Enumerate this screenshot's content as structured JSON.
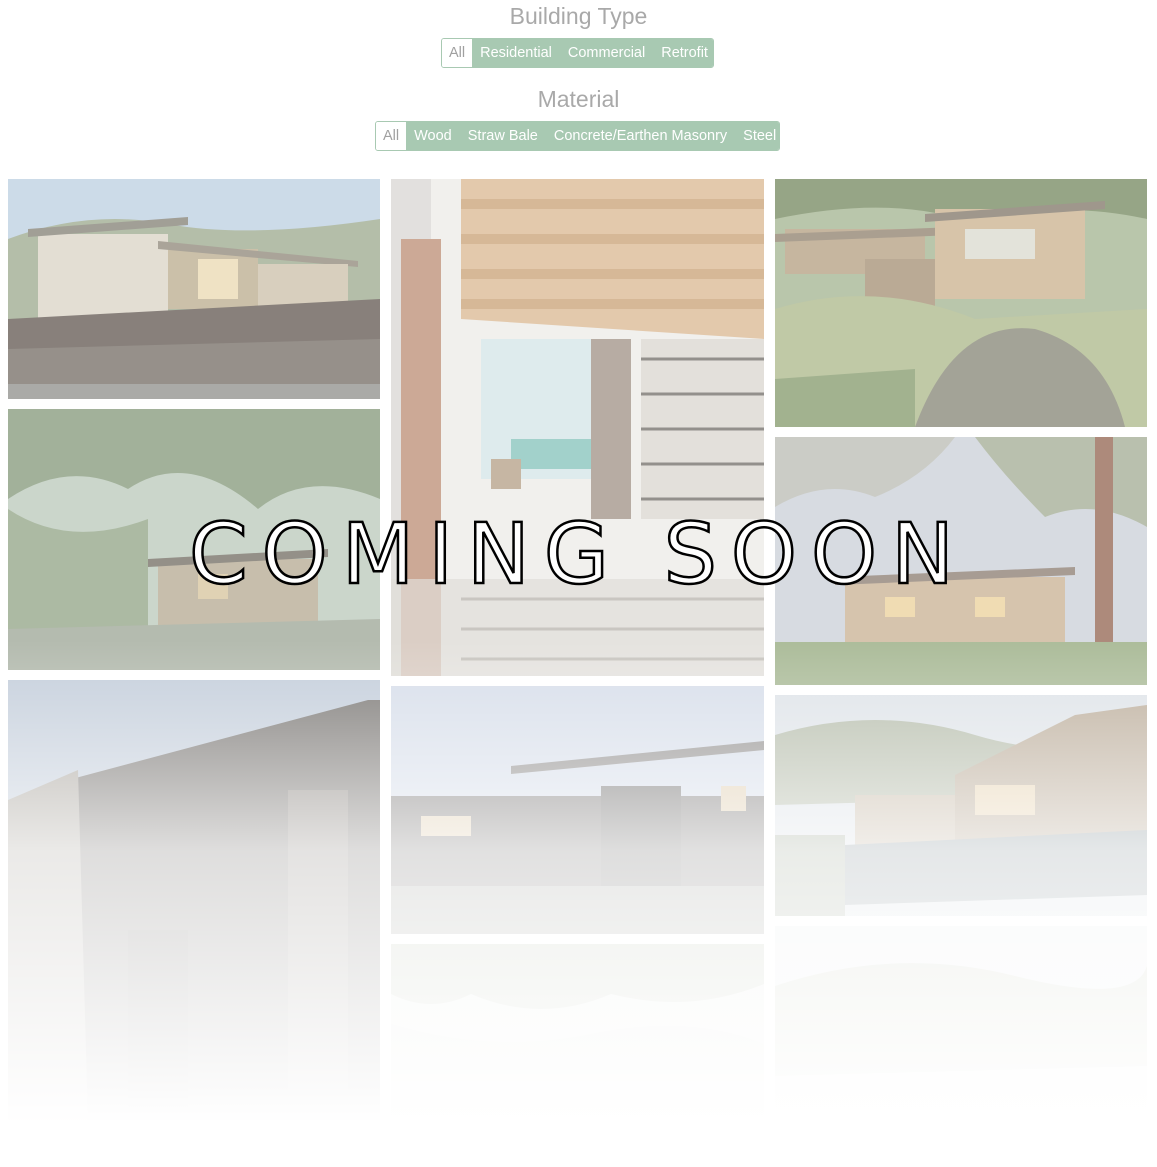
{
  "filters": {
    "building_type": {
      "title": "Building Type",
      "options": [
        "All",
        "Residential",
        "Commercial",
        "Retrofit"
      ],
      "selected": "All"
    },
    "material": {
      "title": "Material",
      "options": [
        "All",
        "Wood",
        "Straw Bale",
        "Concrete/Earthen Masonry",
        "Steel"
      ],
      "selected": "All"
    }
  },
  "overlay": {
    "text": "COMING SOON"
  },
  "gallery": {
    "tiles": [
      {
        "name": "project-photo-1",
        "scene": "modern-house-hillside"
      },
      {
        "name": "project-photo-2",
        "scene": "house-under-oak-trees"
      },
      {
        "name": "project-photo-3",
        "scene": "dark-modern-house"
      },
      {
        "name": "project-photo-4",
        "scene": "interior-wood-ceiling"
      },
      {
        "name": "project-photo-5",
        "scene": "modern-house-dusk"
      },
      {
        "name": "project-photo-6",
        "scene": "trees-faded"
      },
      {
        "name": "project-photo-7",
        "scene": "hillside-house-rocks"
      },
      {
        "name": "project-photo-8",
        "scene": "house-with-trees"
      },
      {
        "name": "project-photo-9",
        "scene": "house-with-pool"
      },
      {
        "name": "project-photo-10",
        "scene": "hills-faded"
      }
    ]
  },
  "colors": {
    "accent": "#a8c9b2",
    "title_gray": "#a9a9a9"
  }
}
